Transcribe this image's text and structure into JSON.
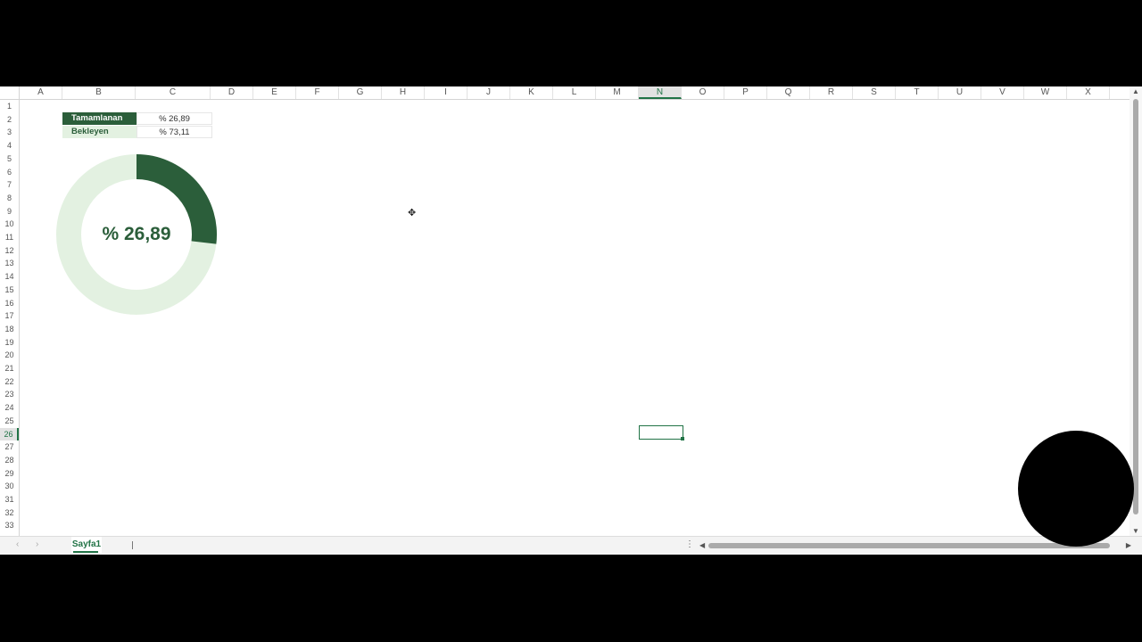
{
  "columns": [
    "A",
    "B",
    "C",
    "D",
    "E",
    "F",
    "G",
    "H",
    "I",
    "J",
    "K",
    "L",
    "M",
    "N",
    "O",
    "P",
    "Q",
    "R",
    "S",
    "T",
    "U",
    "V",
    "W",
    "X"
  ],
  "active_column": "N",
  "rows": [
    "1",
    "2",
    "3",
    "4",
    "5",
    "6",
    "7",
    "8",
    "9",
    "10",
    "11",
    "12",
    "13",
    "14",
    "15",
    "16",
    "17",
    "18",
    "19",
    "20",
    "21",
    "22",
    "23",
    "24",
    "25",
    "26",
    "27",
    "28",
    "29",
    "30",
    "31",
    "32",
    "33"
  ],
  "active_row": "26",
  "table": {
    "completed_label": "Tamamlanan",
    "completed_value": "% 26,89",
    "pending_label": "Bekleyen",
    "pending_value": "% 73,11"
  },
  "chart_data": {
    "type": "pie",
    "categories": [
      "Tamamlanan",
      "Bekleyen"
    ],
    "values": [
      26.89,
      73.11
    ],
    "center_label": "% 26,89",
    "colors": [
      "#2b5e3a",
      "#e3f1e1"
    ]
  },
  "sheet_tabs": [
    "Sayfa1"
  ],
  "colors": {
    "accent": "#217346",
    "dark_green": "#2b5e3a",
    "light_green": "#e3f1e1"
  }
}
